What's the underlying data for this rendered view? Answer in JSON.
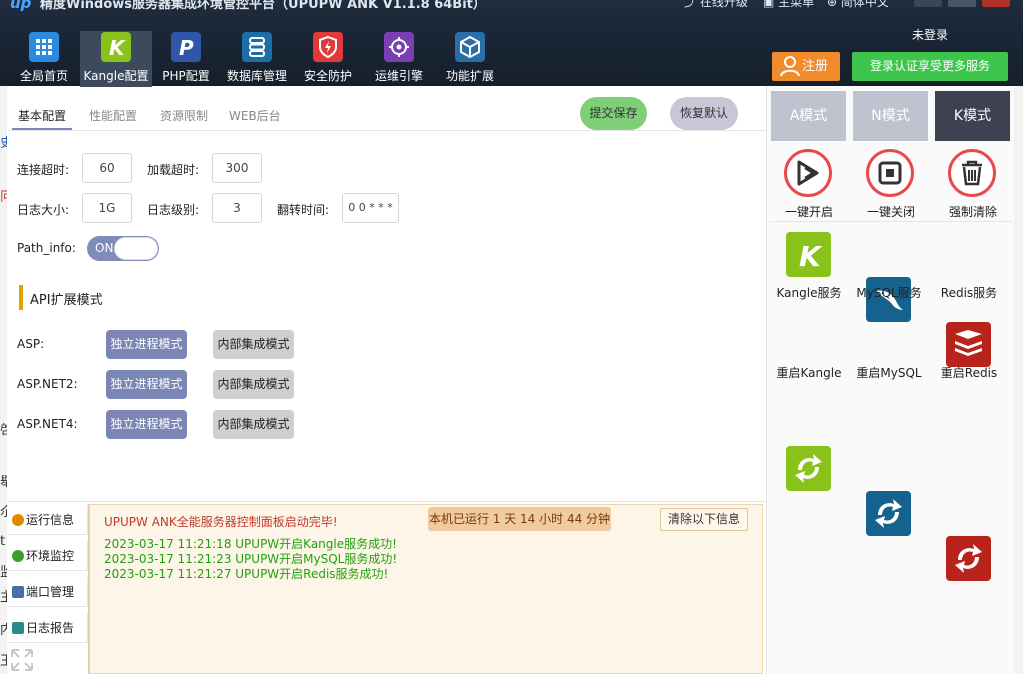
{
  "app": {
    "title": "精度Windows服务器集成环境管控平台（UPUPW ANK V1.1.8 64Bit）",
    "top_links": [
      {
        "label": "在线升级",
        "icon": "upgrade-icon"
      },
      {
        "label": "主菜单",
        "icon": "menu-icon"
      },
      {
        "label": "简体中文",
        "icon": "globe-icon"
      }
    ]
  },
  "nav": {
    "items": [
      {
        "label": "全局首页",
        "icon": "grid-icon",
        "color": "#2a8be0"
      },
      {
        "label": "Kangle配置",
        "icon": "kangle-icon",
        "color": "#8ac21c"
      },
      {
        "label": "PHP配置",
        "icon": "php-icon",
        "color": "#2f56a8"
      },
      {
        "label": "数据库管理",
        "icon": "database-icon",
        "color": "#1b6fa8"
      },
      {
        "label": "安全防护",
        "icon": "shield-icon",
        "color": "#e03a3a"
      },
      {
        "label": "运维引擎",
        "icon": "engine-icon",
        "color": "#7a3fb0"
      },
      {
        "label": "功能扩展",
        "icon": "box-icon",
        "color": "#2a6ea8"
      }
    ]
  },
  "account": {
    "status": "未登录",
    "register_label": "注册",
    "login_label": "登录认证享受更多服务"
  },
  "tabs": [
    "基本配置",
    "性能配置",
    "资源限制",
    "WEB后台"
  ],
  "actions": {
    "save_label": "提交保存",
    "reset_label": "恢复默认"
  },
  "form": {
    "connect_timeout_label": "连接超时:",
    "connect_timeout_value": "60",
    "load_timeout_label": "加载超时:",
    "load_timeout_value": "300",
    "log_size_label": "日志大小:",
    "log_size_value": "1G",
    "log_level_label": "日志级别:",
    "log_level_value": "3",
    "rotate_time_label": "翻转时间:",
    "rotate_time_value": "0 0 * * *",
    "path_info_label": "Path_info:",
    "path_info_state": "ON"
  },
  "api": {
    "heading": "API扩展模式",
    "rows": [
      {
        "label": "ASP:",
        "opt1": "独立进程模式",
        "opt2": "内部集成模式"
      },
      {
        "label": "ASP.NET2:",
        "opt1": "独立进程模式",
        "opt2": "内部集成模式"
      },
      {
        "label": "ASP.NET4:",
        "opt1": "独立进程模式",
        "opt2": "内部集成模式"
      }
    ]
  },
  "right": {
    "modes": [
      "A模式",
      "N模式",
      "K模式"
    ],
    "quick_actions": [
      {
        "label": "一键开启",
        "icon": "play-icon"
      },
      {
        "label": "一键关闭",
        "icon": "stop-icon"
      },
      {
        "label": "强制清除",
        "icon": "trash-icon"
      }
    ],
    "services": [
      {
        "label": "Kangle服务",
        "icon": "kangle-icon",
        "color": "#8ac21c"
      },
      {
        "label": "MySQL服务",
        "icon": "mysql-icon",
        "color": "#15628f"
      },
      {
        "label": "Redis服务",
        "icon": "redis-icon",
        "color": "#b8241c"
      }
    ],
    "restarts": [
      {
        "label": "重启Kangle",
        "icon": "restart-icon",
        "color": "#8ac21c"
      },
      {
        "label": "重启MySQL",
        "icon": "restart-icon",
        "color": "#15628f"
      },
      {
        "label": "重启Redis",
        "icon": "restart-icon",
        "color": "#b8241c"
      }
    ]
  },
  "sidebar": {
    "items": [
      {
        "label": "运行信息",
        "icon": "info-icon",
        "color": "#e08a00"
      },
      {
        "label": "环境监控",
        "icon": "monitor-icon",
        "color": "#3aa02a"
      },
      {
        "label": "端口管理",
        "icon": "port-icon",
        "color": "#4a6ea8"
      },
      {
        "label": "日志报告",
        "icon": "log-icon",
        "color": "#2a8a8a"
      }
    ]
  },
  "log": {
    "title": "UPUPW ANK全能服务器控制面板启动完毕!",
    "uptime": "本机已运行 1 天 14 小时 44 分钟",
    "clear_label": "清除以下信息",
    "lines": [
      "2023-03-17 11:21:18 UPUPW开启Kangle服务成功!",
      "2023-03-17 11:21:23 UPUPW开启MySQL服务成功!",
      "2023-03-17 11:21:27 UPUPW开启Redis服务成功!"
    ]
  },
  "left_strip_chars": [
    "室",
    "史",
    "冋",
    "啓",
    "舉",
    "尒",
    "t",
    "监",
    "主",
    "内",
    "王"
  ]
}
